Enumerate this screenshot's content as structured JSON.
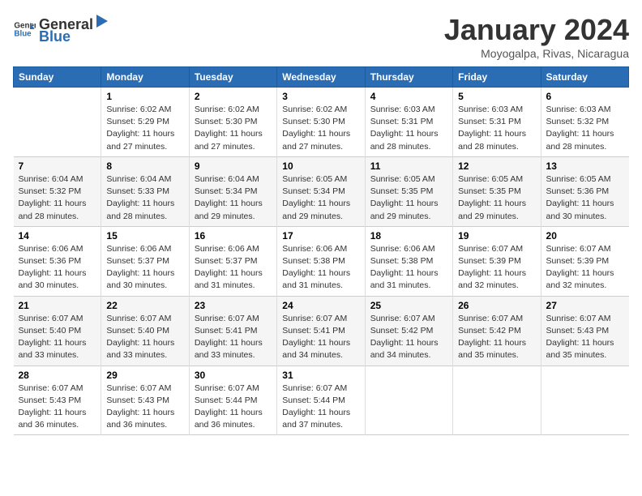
{
  "header": {
    "logo_general": "General",
    "logo_blue": "Blue",
    "title": "January 2024",
    "subtitle": "Moyogalpa, Rivas, Nicaragua"
  },
  "days_of_week": [
    "Sunday",
    "Monday",
    "Tuesday",
    "Wednesday",
    "Thursday",
    "Friday",
    "Saturday"
  ],
  "weeks": [
    [
      {
        "day": "",
        "sunrise": "",
        "sunset": "",
        "daylight": ""
      },
      {
        "day": "1",
        "sunrise": "6:02 AM",
        "sunset": "5:29 PM",
        "daylight": "11 hours and 27 minutes."
      },
      {
        "day": "2",
        "sunrise": "6:02 AM",
        "sunset": "5:30 PM",
        "daylight": "11 hours and 27 minutes."
      },
      {
        "day": "3",
        "sunrise": "6:02 AM",
        "sunset": "5:30 PM",
        "daylight": "11 hours and 27 minutes."
      },
      {
        "day": "4",
        "sunrise": "6:03 AM",
        "sunset": "5:31 PM",
        "daylight": "11 hours and 28 minutes."
      },
      {
        "day": "5",
        "sunrise": "6:03 AM",
        "sunset": "5:31 PM",
        "daylight": "11 hours and 28 minutes."
      },
      {
        "day": "6",
        "sunrise": "6:03 AM",
        "sunset": "5:32 PM",
        "daylight": "11 hours and 28 minutes."
      }
    ],
    [
      {
        "day": "7",
        "sunrise": "6:04 AM",
        "sunset": "5:32 PM",
        "daylight": "11 hours and 28 minutes."
      },
      {
        "day": "8",
        "sunrise": "6:04 AM",
        "sunset": "5:33 PM",
        "daylight": "11 hours and 28 minutes."
      },
      {
        "day": "9",
        "sunrise": "6:04 AM",
        "sunset": "5:34 PM",
        "daylight": "11 hours and 29 minutes."
      },
      {
        "day": "10",
        "sunrise": "6:05 AM",
        "sunset": "5:34 PM",
        "daylight": "11 hours and 29 minutes."
      },
      {
        "day": "11",
        "sunrise": "6:05 AM",
        "sunset": "5:35 PM",
        "daylight": "11 hours and 29 minutes."
      },
      {
        "day": "12",
        "sunrise": "6:05 AM",
        "sunset": "5:35 PM",
        "daylight": "11 hours and 29 minutes."
      },
      {
        "day": "13",
        "sunrise": "6:05 AM",
        "sunset": "5:36 PM",
        "daylight": "11 hours and 30 minutes."
      }
    ],
    [
      {
        "day": "14",
        "sunrise": "6:06 AM",
        "sunset": "5:36 PM",
        "daylight": "11 hours and 30 minutes."
      },
      {
        "day": "15",
        "sunrise": "6:06 AM",
        "sunset": "5:37 PM",
        "daylight": "11 hours and 30 minutes."
      },
      {
        "day": "16",
        "sunrise": "6:06 AM",
        "sunset": "5:37 PM",
        "daylight": "11 hours and 31 minutes."
      },
      {
        "day": "17",
        "sunrise": "6:06 AM",
        "sunset": "5:38 PM",
        "daylight": "11 hours and 31 minutes."
      },
      {
        "day": "18",
        "sunrise": "6:06 AM",
        "sunset": "5:38 PM",
        "daylight": "11 hours and 31 minutes."
      },
      {
        "day": "19",
        "sunrise": "6:07 AM",
        "sunset": "5:39 PM",
        "daylight": "11 hours and 32 minutes."
      },
      {
        "day": "20",
        "sunrise": "6:07 AM",
        "sunset": "5:39 PM",
        "daylight": "11 hours and 32 minutes."
      }
    ],
    [
      {
        "day": "21",
        "sunrise": "6:07 AM",
        "sunset": "5:40 PM",
        "daylight": "11 hours and 33 minutes."
      },
      {
        "day": "22",
        "sunrise": "6:07 AM",
        "sunset": "5:40 PM",
        "daylight": "11 hours and 33 minutes."
      },
      {
        "day": "23",
        "sunrise": "6:07 AM",
        "sunset": "5:41 PM",
        "daylight": "11 hours and 33 minutes."
      },
      {
        "day": "24",
        "sunrise": "6:07 AM",
        "sunset": "5:41 PM",
        "daylight": "11 hours and 34 minutes."
      },
      {
        "day": "25",
        "sunrise": "6:07 AM",
        "sunset": "5:42 PM",
        "daylight": "11 hours and 34 minutes."
      },
      {
        "day": "26",
        "sunrise": "6:07 AM",
        "sunset": "5:42 PM",
        "daylight": "11 hours and 35 minutes."
      },
      {
        "day": "27",
        "sunrise": "6:07 AM",
        "sunset": "5:43 PM",
        "daylight": "11 hours and 35 minutes."
      }
    ],
    [
      {
        "day": "28",
        "sunrise": "6:07 AM",
        "sunset": "5:43 PM",
        "daylight": "11 hours and 36 minutes."
      },
      {
        "day": "29",
        "sunrise": "6:07 AM",
        "sunset": "5:43 PM",
        "daylight": "11 hours and 36 minutes."
      },
      {
        "day": "30",
        "sunrise": "6:07 AM",
        "sunset": "5:44 PM",
        "daylight": "11 hours and 36 minutes."
      },
      {
        "day": "31",
        "sunrise": "6:07 AM",
        "sunset": "5:44 PM",
        "daylight": "11 hours and 37 minutes."
      },
      {
        "day": "",
        "sunrise": "",
        "sunset": "",
        "daylight": ""
      },
      {
        "day": "",
        "sunrise": "",
        "sunset": "",
        "daylight": ""
      },
      {
        "day": "",
        "sunrise": "",
        "sunset": "",
        "daylight": ""
      }
    ]
  ],
  "labels": {
    "sunrise_prefix": "Sunrise: ",
    "sunset_prefix": "Sunset: ",
    "daylight_prefix": "Daylight: "
  }
}
